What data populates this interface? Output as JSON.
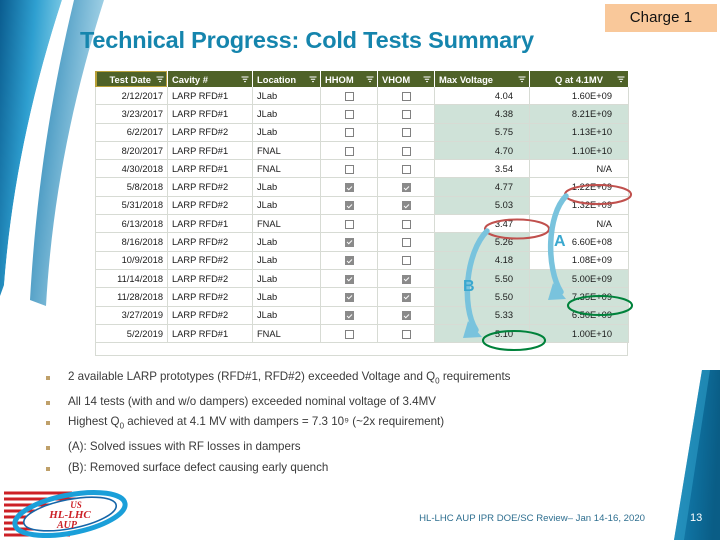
{
  "badge": {
    "label": "Charge 1",
    "bg": "#f9c89a"
  },
  "title": {
    "text": "Technical Progress: Cold Tests Summary",
    "color": "#1585ad"
  },
  "table": {
    "columns": [
      {
        "key": "test_date",
        "label": "Test Date",
        "filter_icon": "filter-icon"
      },
      {
        "key": "cavity",
        "label": "Cavity #",
        "filter_icon": "filter-icon"
      },
      {
        "key": "location",
        "label": "Location",
        "filter_icon": "filter-icon"
      },
      {
        "key": "hhom",
        "label": "HHOM",
        "filter_icon": "filter-icon"
      },
      {
        "key": "vhom",
        "label": "VHOM",
        "filter_icon": "filter-icon"
      },
      {
        "key": "max_voltage",
        "label": "Max Voltage",
        "filter_icon": "filter-icon"
      },
      {
        "key": "q_at_41mv",
        "label": "Q at 4.1MV",
        "filter_icon": "filter-icon"
      }
    ],
    "header_bg": "#4f6228",
    "highlight_bg": "#cfe2d8",
    "rows": [
      {
        "test_date": "2/12/2017",
        "cavity": "LARP RFD#1",
        "location": "JLab",
        "hhom": false,
        "vhom": false,
        "max_voltage": "4.04",
        "q_at_41mv": "1.60E+09",
        "hl_v": false,
        "hl_q": false
      },
      {
        "test_date": "3/23/2017",
        "cavity": "LARP RFD#1",
        "location": "JLab",
        "hhom": false,
        "vhom": false,
        "max_voltage": "4.38",
        "q_at_41mv": "8.21E+09",
        "hl_v": true,
        "hl_q": true
      },
      {
        "test_date": "6/2/2017",
        "cavity": "LARP RFD#2",
        "location": "JLab",
        "hhom": false,
        "vhom": false,
        "max_voltage": "5.75",
        "q_at_41mv": "1.13E+10",
        "hl_v": true,
        "hl_q": true
      },
      {
        "test_date": "8/20/2017",
        "cavity": "LARP RFD#1",
        "location": "FNAL",
        "hhom": false,
        "vhom": false,
        "max_voltage": "4.70",
        "q_at_41mv": "1.10E+10",
        "hl_v": true,
        "hl_q": true
      },
      {
        "test_date": "4/30/2018",
        "cavity": "LARP RFD#1",
        "location": "FNAL",
        "hhom": false,
        "vhom": false,
        "max_voltage": "3.54",
        "q_at_41mv": "N/A",
        "hl_v": false,
        "hl_q": false
      },
      {
        "test_date": "5/8/2018",
        "cavity": "LARP RFD#2",
        "location": "JLab",
        "hhom": true,
        "vhom": true,
        "max_voltage": "4.77",
        "q_at_41mv": "1.22E+09",
        "hl_v": true,
        "hl_q": false
      },
      {
        "test_date": "5/31/2018",
        "cavity": "LARP RFD#2",
        "location": "JLab",
        "hhom": true,
        "vhom": true,
        "max_voltage": "5.03",
        "q_at_41mv": "1.32E+09",
        "hl_v": true,
        "hl_q": false
      },
      {
        "test_date": "6/13/2018",
        "cavity": "LARP RFD#1",
        "location": "FNAL",
        "hhom": false,
        "vhom": false,
        "max_voltage": "3.47",
        "q_at_41mv": "N/A",
        "hl_v": false,
        "hl_q": false
      },
      {
        "test_date": "8/16/2018",
        "cavity": "LARP RFD#2",
        "location": "JLab",
        "hhom": true,
        "vhom": false,
        "max_voltage": "5.26",
        "q_at_41mv": "6.60E+08",
        "hl_v": true,
        "hl_q": false
      },
      {
        "test_date": "10/9/2018",
        "cavity": "LARP RFD#2",
        "location": "JLab",
        "hhom": true,
        "vhom": false,
        "max_voltage": "4.18",
        "q_at_41mv": "1.08E+09",
        "hl_v": true,
        "hl_q": false
      },
      {
        "test_date": "11/14/2018",
        "cavity": "LARP RFD#2",
        "location": "JLab",
        "hhom": true,
        "vhom": true,
        "max_voltage": "5.50",
        "q_at_41mv": "5.00E+09",
        "hl_v": true,
        "hl_q": true
      },
      {
        "test_date": "11/28/2018",
        "cavity": "LARP RFD#2",
        "location": "JLab",
        "hhom": true,
        "vhom": true,
        "max_voltage": "5.50",
        "q_at_41mv": "7.35E+09",
        "hl_v": true,
        "hl_q": true
      },
      {
        "test_date": "3/27/2019",
        "cavity": "LARP RFD#2",
        "location": "JLab",
        "hhom": true,
        "vhom": true,
        "max_voltage": "5.33",
        "q_at_41mv": "6.50E+09",
        "hl_v": true,
        "hl_q": true
      },
      {
        "test_date": "5/2/2019",
        "cavity": "LARP RFD#1",
        "location": "FNAL",
        "hhom": false,
        "vhom": false,
        "max_voltage": "5.10",
        "q_at_41mv": "1.00E+10",
        "hl_v": true,
        "hl_q": true
      }
    ]
  },
  "annotations": {
    "label_a": "A",
    "label_b": "B",
    "arrow_color": "#79c3dd",
    "red_ellipse_color": "#c0504d",
    "green_ellipse_color": "#00823b",
    "red_circles": [
      "1.22E+09",
      "3.47"
    ],
    "green_circles": [
      "7.35E+09",
      "5.10"
    ]
  },
  "bullets": [
    {
      "prefix": "2 available LARP prototypes (RFD#1, RFD#2) exceeded Voltage and Q",
      "sub": "0",
      "suffix": " requirements"
    },
    {
      "prefix": "All 14 tests (with and w/o dampers) exceeded nominal voltage of 3.4MV",
      "sub": "",
      "suffix": ""
    },
    {
      "prefix": "Highest Q",
      "sub": "0",
      "suffix": " achieved at 4.1 MV with dampers = 7.3 10⁹ (~2x requirement)"
    },
    {
      "prefix": "(A): Solved issues with RF losses in dampers",
      "sub": "",
      "suffix": ""
    },
    {
      "prefix": "(B): Removed surface defect causing early quench",
      "sub": "",
      "suffix": ""
    }
  ],
  "footer": {
    "note": "HL-LHC AUP IPR DOE/SC Review– Jan 14-16, 2020",
    "page_number": "13",
    "logo_lines": [
      "US",
      "HL-LHC",
      "AUP"
    ]
  }
}
